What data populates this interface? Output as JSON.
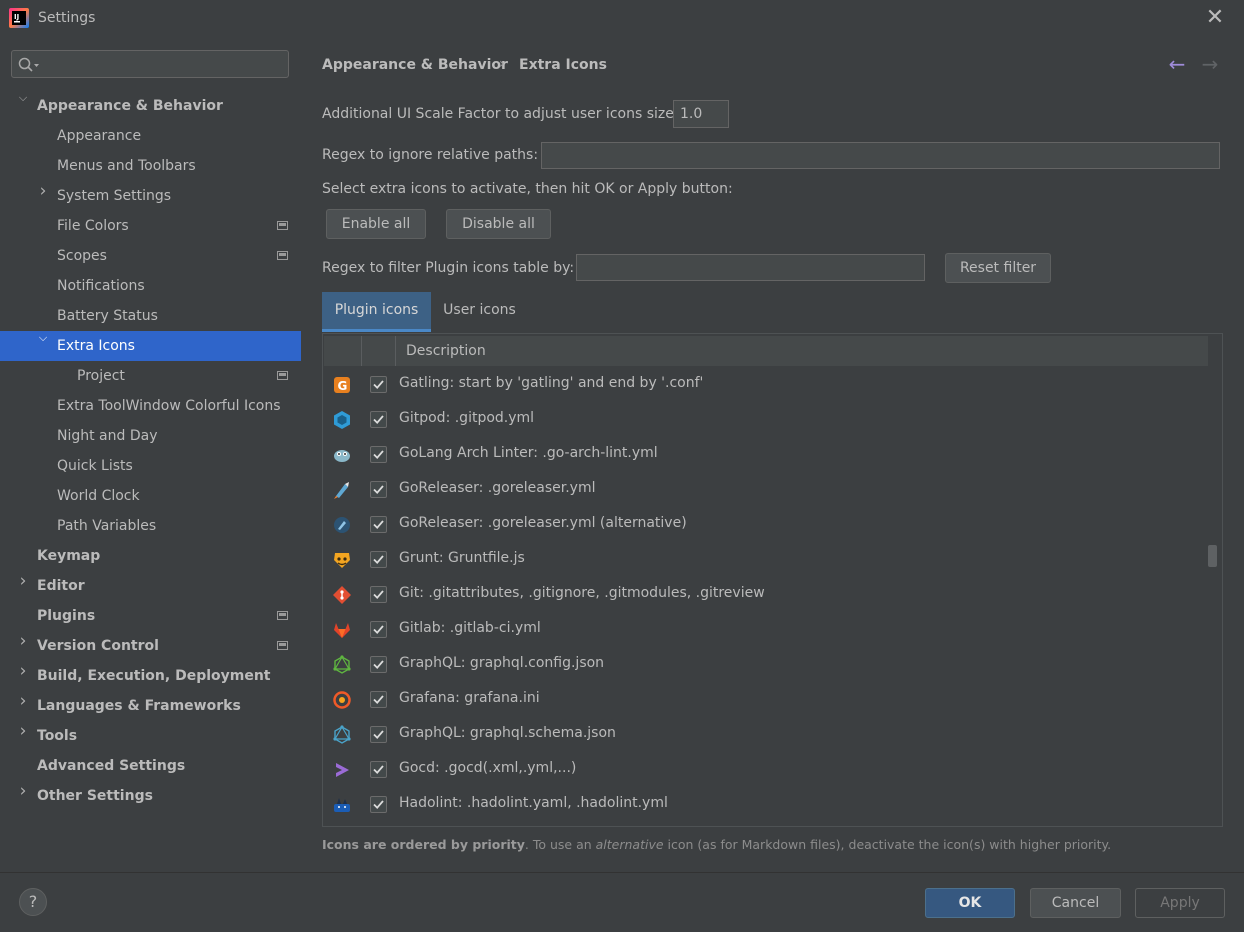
{
  "window": {
    "title": "Settings"
  },
  "search": {
    "placeholder": ""
  },
  "sidebar": {
    "items": [
      {
        "label": "Appearance & Behavior",
        "bold": true,
        "expanded": true
      },
      {
        "label": "Appearance"
      },
      {
        "label": "Menus and Toolbars"
      },
      {
        "label": "System Settings",
        "expandable": true
      },
      {
        "label": "File Colors",
        "badge": true
      },
      {
        "label": "Scopes",
        "badge": true
      },
      {
        "label": "Notifications"
      },
      {
        "label": "Battery Status"
      },
      {
        "label": "Extra Icons",
        "selected": true,
        "expanded": true
      },
      {
        "label": "Project",
        "badge": true
      },
      {
        "label": "Extra ToolWindow Colorful Icons"
      },
      {
        "label": "Night and Day"
      },
      {
        "label": "Quick Lists"
      },
      {
        "label": "World Clock"
      },
      {
        "label": "Path Variables"
      },
      {
        "label": "Keymap",
        "bold": true
      },
      {
        "label": "Editor",
        "bold": true,
        "expandable": true
      },
      {
        "label": "Plugins",
        "bold": true,
        "badge": true
      },
      {
        "label": "Version Control",
        "bold": true,
        "expandable": true,
        "badge": true
      },
      {
        "label": "Build, Execution, Deployment",
        "bold": true,
        "expandable": true
      },
      {
        "label": "Languages & Frameworks",
        "bold": true,
        "expandable": true
      },
      {
        "label": "Tools",
        "bold": true,
        "expandable": true
      },
      {
        "label": "Advanced Settings",
        "bold": true
      },
      {
        "label": "Other Settings",
        "bold": true,
        "expandable": true
      }
    ]
  },
  "breadcrumb": {
    "parent": "Appearance & Behavior",
    "separator": "›",
    "current": "Extra Icons"
  },
  "nav": {
    "back": "←",
    "forward": "→"
  },
  "settings": {
    "scale_label": "Additional UI Scale Factor to adjust user icons size:",
    "scale_value": "1.0",
    "regex_ignore_label": "Regex to ignore relative paths:",
    "regex_ignore_value": "",
    "select_label": "Select extra icons to activate, then hit OK or Apply button:",
    "enable_all": "Enable all",
    "disable_all": "Disable all",
    "regex_filter_label": "Regex to filter Plugin icons table by:",
    "regex_filter_value": "",
    "reset_filter": "Reset filter"
  },
  "tabs": [
    {
      "label": "Plugin icons",
      "active": true
    },
    {
      "label": "User icons",
      "active": false
    }
  ],
  "table": {
    "header": "Description",
    "rows": [
      {
        "icon": "gatling-icon",
        "checked": true,
        "text": "Gatling: start by 'gatling' and end by '.conf'"
      },
      {
        "icon": "gitpod-icon",
        "checked": true,
        "text": "Gitpod: .gitpod.yml"
      },
      {
        "icon": "golang-arch-linter-icon",
        "checked": true,
        "text": "GoLang Arch Linter: .go-arch-lint.yml"
      },
      {
        "icon": "goreleaser-icon",
        "checked": true,
        "text": "GoReleaser: .goreleaser.yml"
      },
      {
        "icon": "goreleaser-alt-icon",
        "checked": true,
        "text": "GoReleaser: .goreleaser.yml (alternative)"
      },
      {
        "icon": "grunt-icon",
        "checked": true,
        "text": "Grunt: Gruntfile.js"
      },
      {
        "icon": "git-icon",
        "checked": true,
        "text": "Git: .gitattributes, .gitignore, .gitmodules, .gitreview"
      },
      {
        "icon": "gitlab-icon",
        "checked": true,
        "text": "Gitlab: .gitlab-ci.yml"
      },
      {
        "icon": "graphql-config-icon",
        "checked": true,
        "text": "GraphQL: graphql.config.json"
      },
      {
        "icon": "grafana-icon",
        "checked": true,
        "text": "Grafana: grafana.ini"
      },
      {
        "icon": "graphql-schema-icon",
        "checked": true,
        "text": "GraphQL: graphql.schema.json"
      },
      {
        "icon": "gocd-icon",
        "checked": true,
        "text": "Gocd: .gocd(.xml,.yml,...)"
      },
      {
        "icon": "hadolint-icon",
        "checked": true,
        "text": "Hadolint: .hadolint.yaml, .hadolint.yml"
      }
    ]
  },
  "footnote": {
    "bold": "Icons are ordered by priority",
    "part1": ". To use an ",
    "italic": "alternative",
    "part2": " icon (as for Markdown files), deactivate the icon(s) with higher priority."
  },
  "footer": {
    "help": "?",
    "ok": "OK",
    "cancel": "Cancel",
    "apply": "Apply"
  },
  "colors": {
    "background": "#3c3f41",
    "selection": "#2f65ca",
    "accent": "#365880",
    "active_tab": "#3d6185"
  }
}
